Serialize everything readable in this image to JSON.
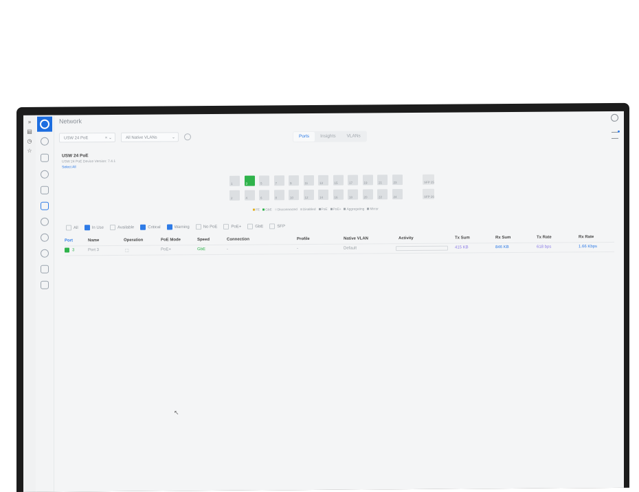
{
  "app": {
    "title": "Network"
  },
  "toolbar": {
    "device_select": "USW 24 PoE",
    "vlan_select": "All Native VLANs"
  },
  "tabs": [
    "Ports",
    "Insights",
    "VLANs"
  ],
  "device": {
    "name": "USW 24 PoE",
    "subtitle": "USW 24 PoE   Device Version: 7.4.1",
    "link": "Select All"
  },
  "ports_top": [
    "1",
    "3",
    "5",
    "7",
    "9",
    "11",
    "13",
    "15",
    "17",
    "19",
    "21",
    "23"
  ],
  "ports_bottom": [
    "2",
    "4",
    "6",
    "8",
    "10",
    "12",
    "14",
    "16",
    "18",
    "20",
    "22",
    "24"
  ],
  "sfp": [
    "SFP 25",
    "SFP 26"
  ],
  "legend": [
    "FE",
    "GbE",
    "Disconnected",
    "Disabled",
    "PoE",
    "PoE+",
    "Aggregating",
    "Mirror"
  ],
  "filters": [
    {
      "label": "All",
      "checked": false
    },
    {
      "label": "In Use",
      "checked": true
    },
    {
      "label": "Available",
      "checked": false
    },
    {
      "label": "Critical",
      "checked": true
    },
    {
      "label": "Warning",
      "checked": true
    },
    {
      "label": "No PoE",
      "checked": false
    },
    {
      "label": "PoE+",
      "checked": false
    },
    {
      "label": "GbE",
      "checked": false
    },
    {
      "label": "SFP",
      "checked": false
    }
  ],
  "table": {
    "headers": {
      "port": "Port",
      "name": "Name",
      "operation": "Operation",
      "poe_mode": "PoE Mode",
      "speed": "Speed",
      "connection": "Connection",
      "profile": "Profile",
      "native_vlan": "Native VLAN",
      "activity": "Activity",
      "tx_sum": "Tx Sum",
      "rx_sum": "Rx Sum",
      "tx_rate": "Tx Rate",
      "rx_rate": "Rx Rate"
    },
    "row": {
      "port": "3",
      "name": "Port 3",
      "poe_mode": "PoE+",
      "speed": "GbE",
      "connection": "-",
      "profile": "-",
      "native_vlan": "Default",
      "tx_sum": "415 KB",
      "rx_sum": "846 KB",
      "tx_rate": "618 bps",
      "rx_rate": "1.66 Kbps"
    }
  },
  "colors": {
    "accent": "#2e7be6",
    "port_active": "#2fb34b",
    "logo": "#1d6ee0"
  }
}
